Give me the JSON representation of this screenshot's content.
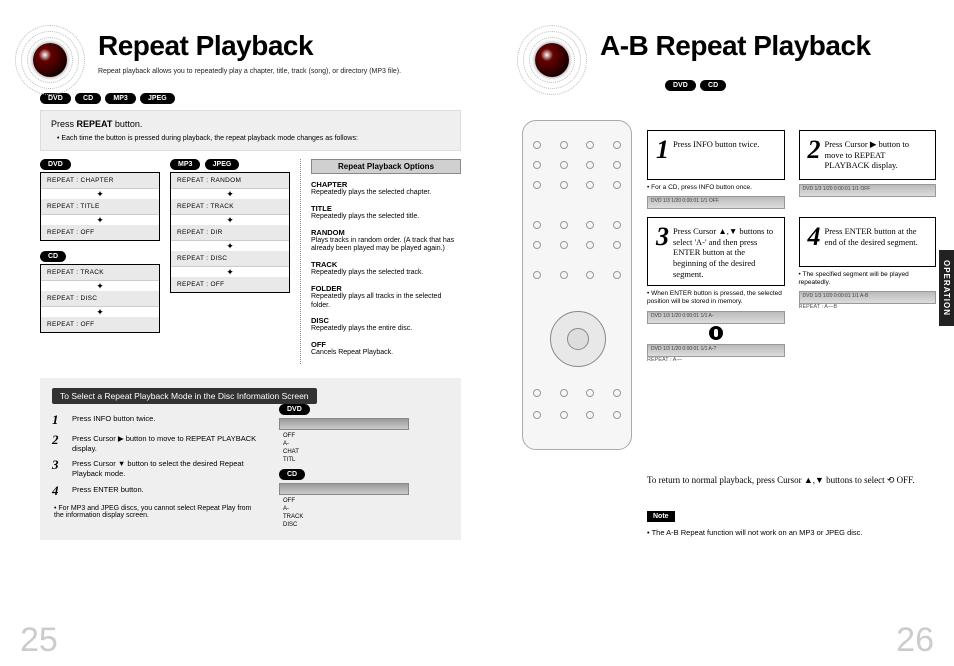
{
  "left": {
    "title": "Repeat Playback",
    "subtitle": "Repeat playback allows you to repeatedly play a chapter, title, track (song), or directory (MP3 file).",
    "format_pills": [
      "DVD",
      "CD",
      "MP3",
      "JPEG"
    ],
    "box_head_pre": "Press ",
    "box_head_btn": "REPEAT",
    "box_head_post": " button.",
    "box_bullet": "Each time the button is pressed during playback, the repeat playback mode changes as follows:",
    "flow_dvd_label": "DVD",
    "flow_dvd": [
      "REPEAT : CHAPTER",
      "REPEAT : TITLE",
      "REPEAT : OFF"
    ],
    "flow_cd_label": "CD",
    "flow_cd": [
      "REPEAT : TRACK",
      "REPEAT : DISC",
      "REPEAT : OFF"
    ],
    "flow_mp3_labels": [
      "MP3",
      "JPEG"
    ],
    "flow_mp3": [
      "REPEAT : RANDOM",
      "REPEAT : TRACK",
      "REPEAT : DIR",
      "REPEAT : DISC",
      "REPEAT : OFF"
    ],
    "options_title": "Repeat Playback Options",
    "options": [
      {
        "k": "CHAPTER",
        "v": "Repeatedly plays the selected chapter."
      },
      {
        "k": "TITLE",
        "v": "Repeatedly plays the selected title."
      },
      {
        "k": "RANDOM",
        "v": "Plays tracks in random order. (A track that has already been played may be played again.)"
      },
      {
        "k": "TRACK",
        "v": "Repeatedly plays the selected track."
      },
      {
        "k": "FOLDER",
        "v": "Repeatedly plays all tracks in the selected folder."
      },
      {
        "k": "DISC",
        "v": "Repeatedly plays the entire disc."
      },
      {
        "k": "OFF",
        "v": "Cancels Repeat Playback."
      }
    ],
    "select_strip": "To Select a Repeat Playback Mode in the Disc Information Screen",
    "steps": [
      "Press INFO button twice.",
      "Press Cursor ▶ button to move to REPEAT PLAYBACK display.",
      "Press Cursor ▼ button to select the desired Repeat Playback mode.",
      "Press ENTER button."
    ],
    "step_foot": "For MP3 and JPEG discs, you cannot select Repeat Play from the information display screen.",
    "disp_dvd_label": "DVD",
    "disp_dvd_items": [
      "OFF",
      "A-",
      "CHAT",
      "TITL"
    ],
    "disp_cd_label": "CD",
    "disp_cd_items": [
      "OFF",
      "A-",
      "TRACK",
      "DISC"
    ],
    "page_num": "25"
  },
  "right": {
    "title": "A-B Repeat Playback",
    "format_pills": [
      "DVD",
      "CD"
    ],
    "operation_tab": "OPERATION",
    "steps": [
      {
        "n": "1",
        "text": "Press INFO button twice.",
        "sub": "For a CD, press INFO button once.",
        "disp": "DVD  1/3  1/20  0:00:01  1/1  OFF"
      },
      {
        "n": "2",
        "text": "Press Cursor ▶ button to move to REPEAT PLAYBACK display.",
        "sub": "",
        "disp": "DVD  1/3  1/20  0:00:01  1/1  OFF"
      },
      {
        "n": "3",
        "text": "Press Cursor ▲,▼ buttons to select 'A-' and then press ENTER button at the beginning of the desired segment.",
        "sub": "When ENTER button is pressed, the selected position will be stored in memory.",
        "disp": "DVD  1/3  1/20  0:00:01  1/1  A-",
        "disp2": "DVD  1/3  1/20  0:00:01  1/1  A-?",
        "repeat_line": "REPEAT : A—"
      },
      {
        "n": "4",
        "text": "Press ENTER button at the end of the desired segment.",
        "sub": "The specified segment will be played repeatedly.",
        "disp": "DVD  1/3  1/20  0:00:01  1/1  A-B",
        "repeat_line": "REPEAT : A—B"
      }
    ],
    "return_line": "To return to normal playback, press Cursor ▲,▼ buttons to select ⟲ OFF.",
    "note_label": "Note",
    "note_text": "The A-B Repeat function will not work on an MP3 or JPEG disc.",
    "page_num": "26"
  }
}
